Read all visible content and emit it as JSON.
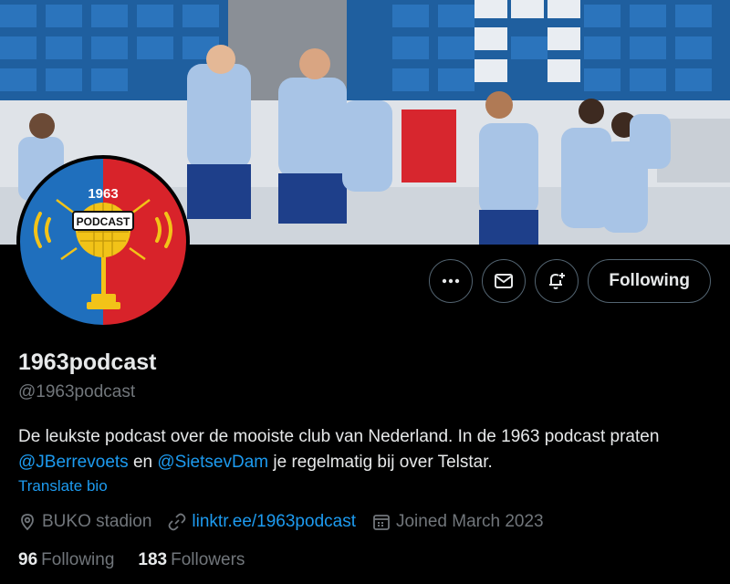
{
  "profile": {
    "display_name": "1963podcast",
    "handle": "@1963podcast",
    "avatar": {
      "badge_year": "1963",
      "badge_word": "PODCAST"
    }
  },
  "actions": {
    "more_icon": "more-horizontal-icon",
    "message_icon": "envelope-icon",
    "notify_icon": "bell-plus-icon",
    "follow_label": "Following"
  },
  "bio": {
    "part1": "De leukste podcast over de mooiste club van Nederland. In de 1963 podcast praten ",
    "mention1": "@JBerrevoets",
    "part2": " en ",
    "mention2": "@SietsevDam",
    "part3": " je regelmatig bij over Telstar.",
    "translate_label": "Translate bio"
  },
  "meta": {
    "location": "BUKO stadion",
    "link": "linktr.ee/1963podcast",
    "joined": "Joined March 2023"
  },
  "stats": {
    "following_count": "96",
    "following_label": "Following",
    "followers_count": "183",
    "followers_label": "Followers"
  },
  "colors": {
    "background": "#000000",
    "accent": "#1d9bf0",
    "secondary_text": "#71767b",
    "avatar_blue": "#1f6fbd",
    "avatar_red": "#d8232a"
  }
}
